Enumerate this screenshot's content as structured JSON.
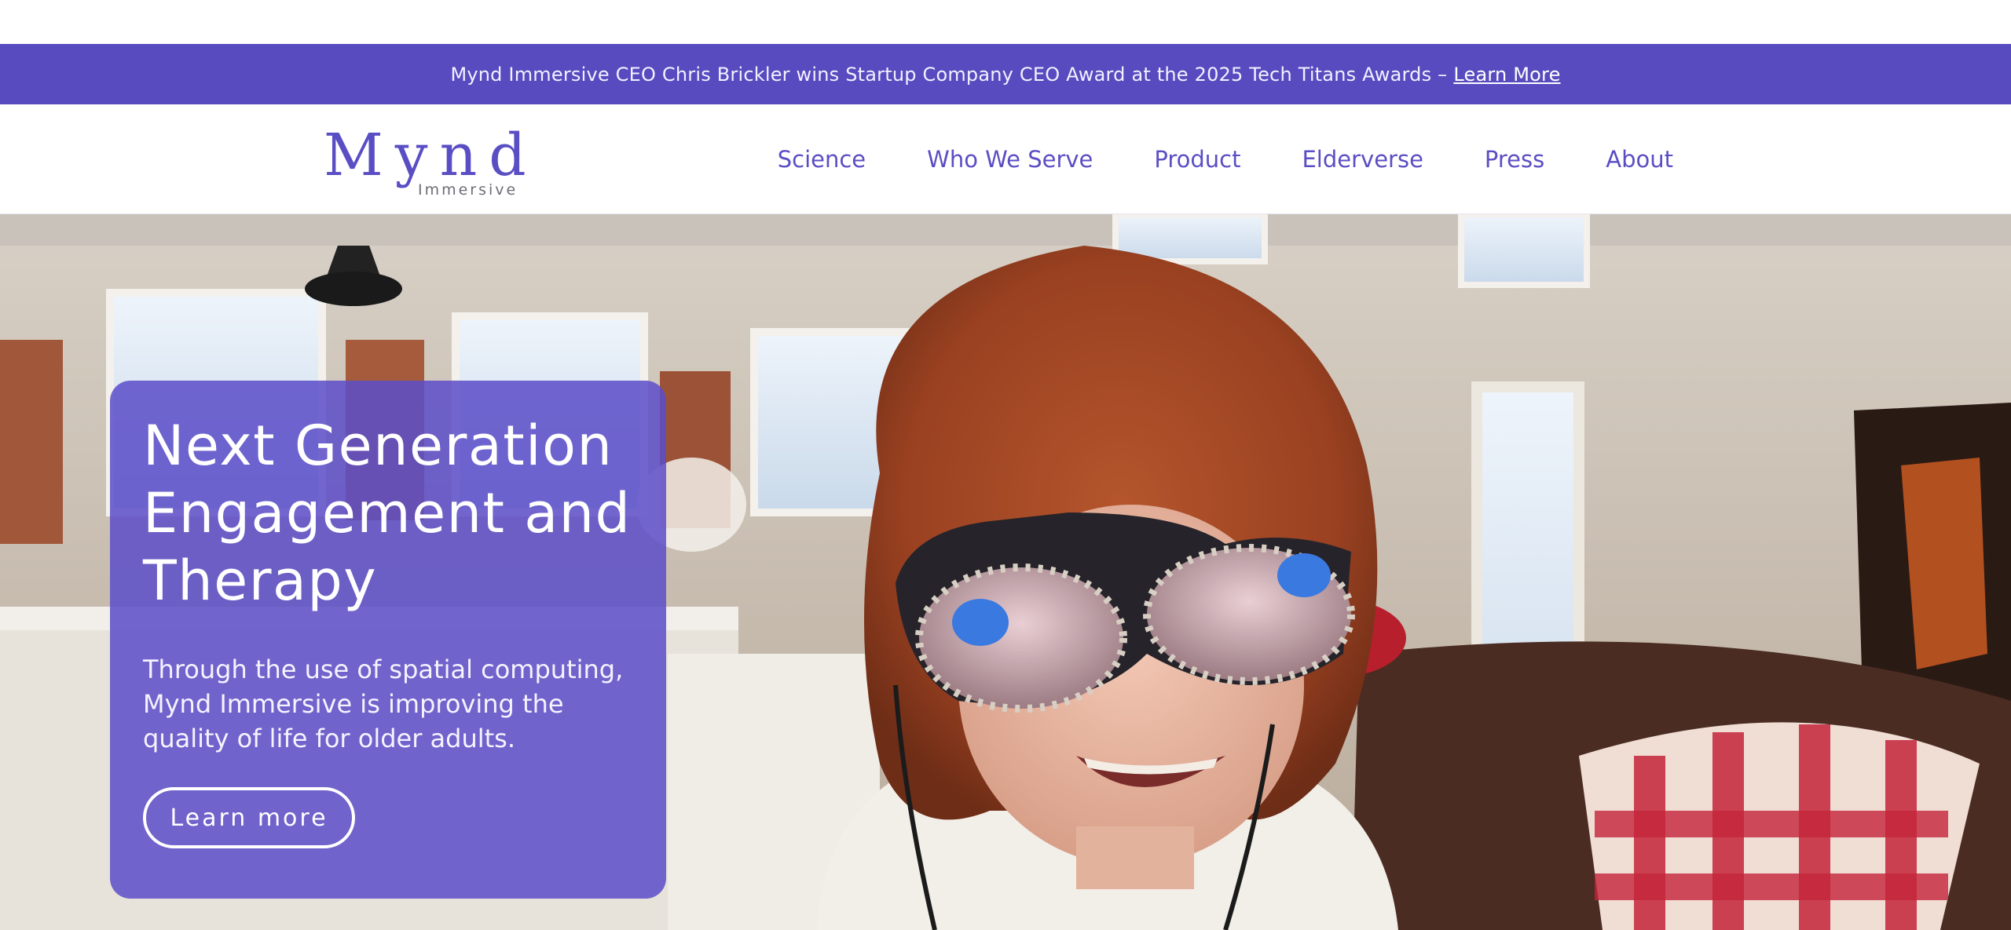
{
  "announcement": {
    "text": "Mynd Immersive CEO Chris Brickler wins Startup Company CEO Award at the 2025 Tech Titans Awards –",
    "link_label": "Learn More"
  },
  "brand": {
    "wordmark": "Mynd",
    "subtitle": "Immersive"
  },
  "nav": {
    "items": [
      {
        "label": "Science"
      },
      {
        "label": "Who We Serve"
      },
      {
        "label": "Product"
      },
      {
        "label": "Elderverse"
      },
      {
        "label": "Press"
      },
      {
        "label": "About"
      }
    ]
  },
  "hero": {
    "title": "Next Generation Engagement and Therapy",
    "subtitle": "Through the use of spatial computing, Mynd Immersive is improving the quality of life for older adults.",
    "cta_label": "Learn more",
    "image": "woman-wearing-vr-headset-in-living-room"
  },
  "colors": {
    "brand_purple": "#574bbf",
    "nav_text": "#5a4ec4",
    "card_overlay": "#5c4ec8",
    "white": "#ffffff"
  }
}
